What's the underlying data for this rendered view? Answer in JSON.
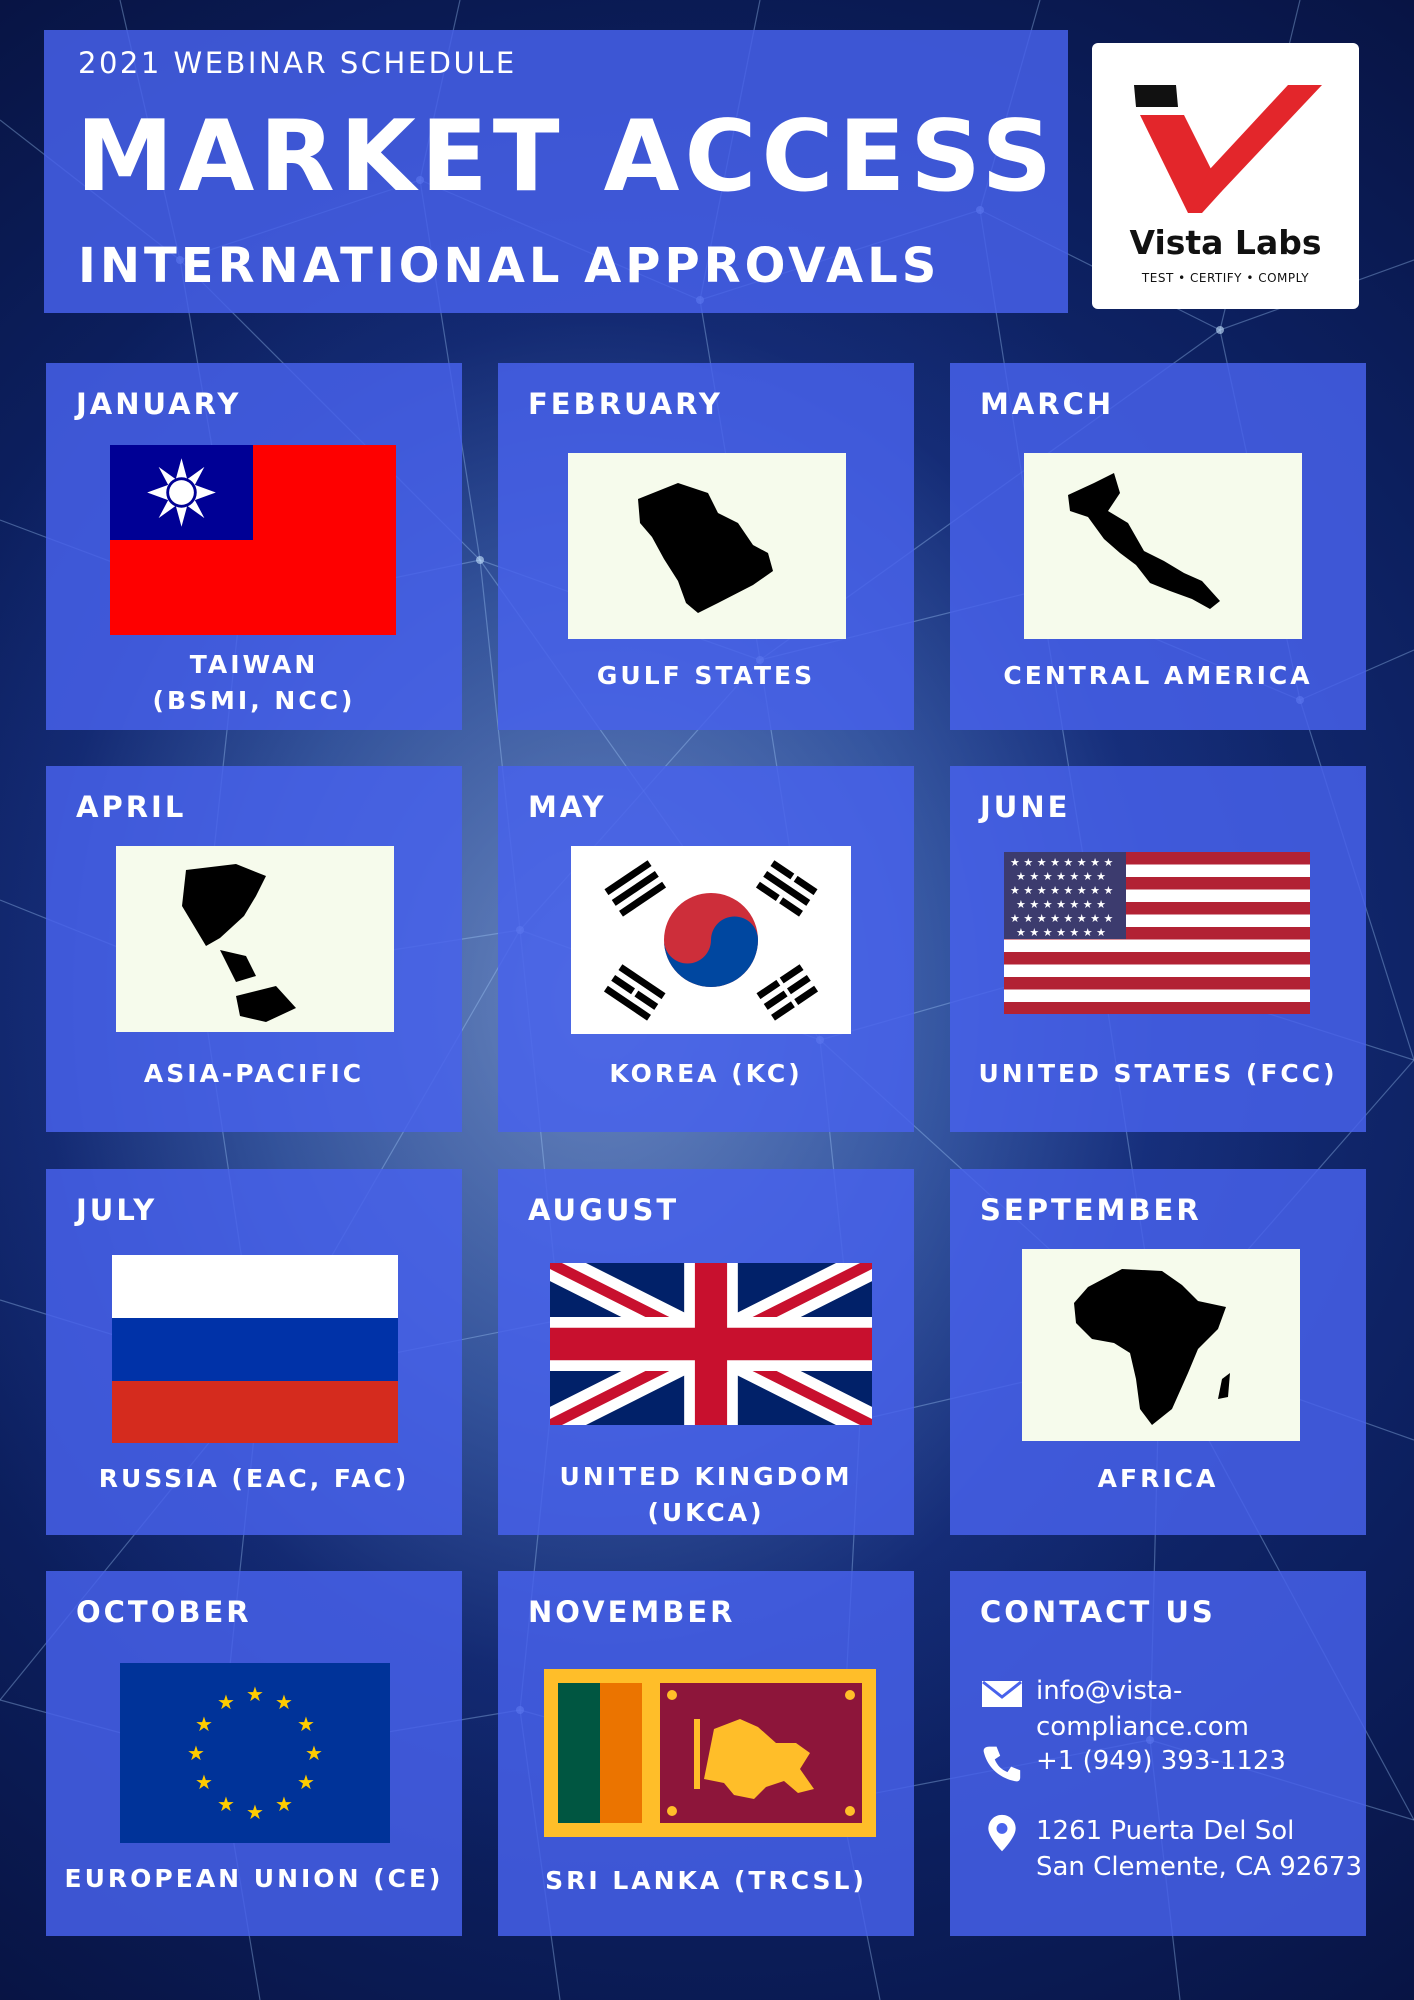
{
  "header": {
    "kicker": "2021 WEBINAR SCHEDULE",
    "title": "MARKET ACCESS",
    "subtitle": "INTERNATIONAL APPROVALS"
  },
  "logo": {
    "name": "Vista Labs",
    "tagline": "TEST • CERTIFY • COMPLY",
    "accent_color": "#e3262b"
  },
  "colors": {
    "panel": "#4862ec",
    "text": "#ffffff"
  },
  "schedule": [
    {
      "month": "JANUARY",
      "label": "TAIWAN\n(BSMI, NCC)",
      "image": "taiwan-flag-icon"
    },
    {
      "month": "FEBRUARY",
      "label": "GULF STATES",
      "image": "gulf-states-map-icon"
    },
    {
      "month": "MARCH",
      "label": "CENTRAL AMERICA",
      "image": "central-america-map-icon"
    },
    {
      "month": "APRIL",
      "label": "ASIA-PACIFIC",
      "image": "asia-pacific-map-icon"
    },
    {
      "month": "MAY",
      "label": "KOREA (KC)",
      "image": "korea-flag-icon"
    },
    {
      "month": "JUNE",
      "label": "UNITED STATES (FCC)",
      "image": "usa-flag-icon"
    },
    {
      "month": "JULY",
      "label": "RUSSIA (EAC, FAC)",
      "image": "russia-flag-icon"
    },
    {
      "month": "AUGUST",
      "label": "UNITED KINGDOM (UKCA)",
      "image": "uk-flag-icon"
    },
    {
      "month": "SEPTEMBER",
      "label": "AFRICA",
      "image": "africa-map-icon"
    },
    {
      "month": "OCTOBER",
      "label": "EUROPEAN  UNION (CE)",
      "image": "eu-flag-icon"
    },
    {
      "month": "NOVEMBER",
      "label": "SRI LANKA (TRCSL)",
      "image": "sri-lanka-flag-icon"
    }
  ],
  "contact": {
    "heading": "CONTACT US",
    "email": "info@vista-compliance.com",
    "phone": "+1 (949) 393-1123",
    "address_line1": "1261 Puerta Del Sol",
    "address_line2": "San Clemente, CA 92673"
  }
}
